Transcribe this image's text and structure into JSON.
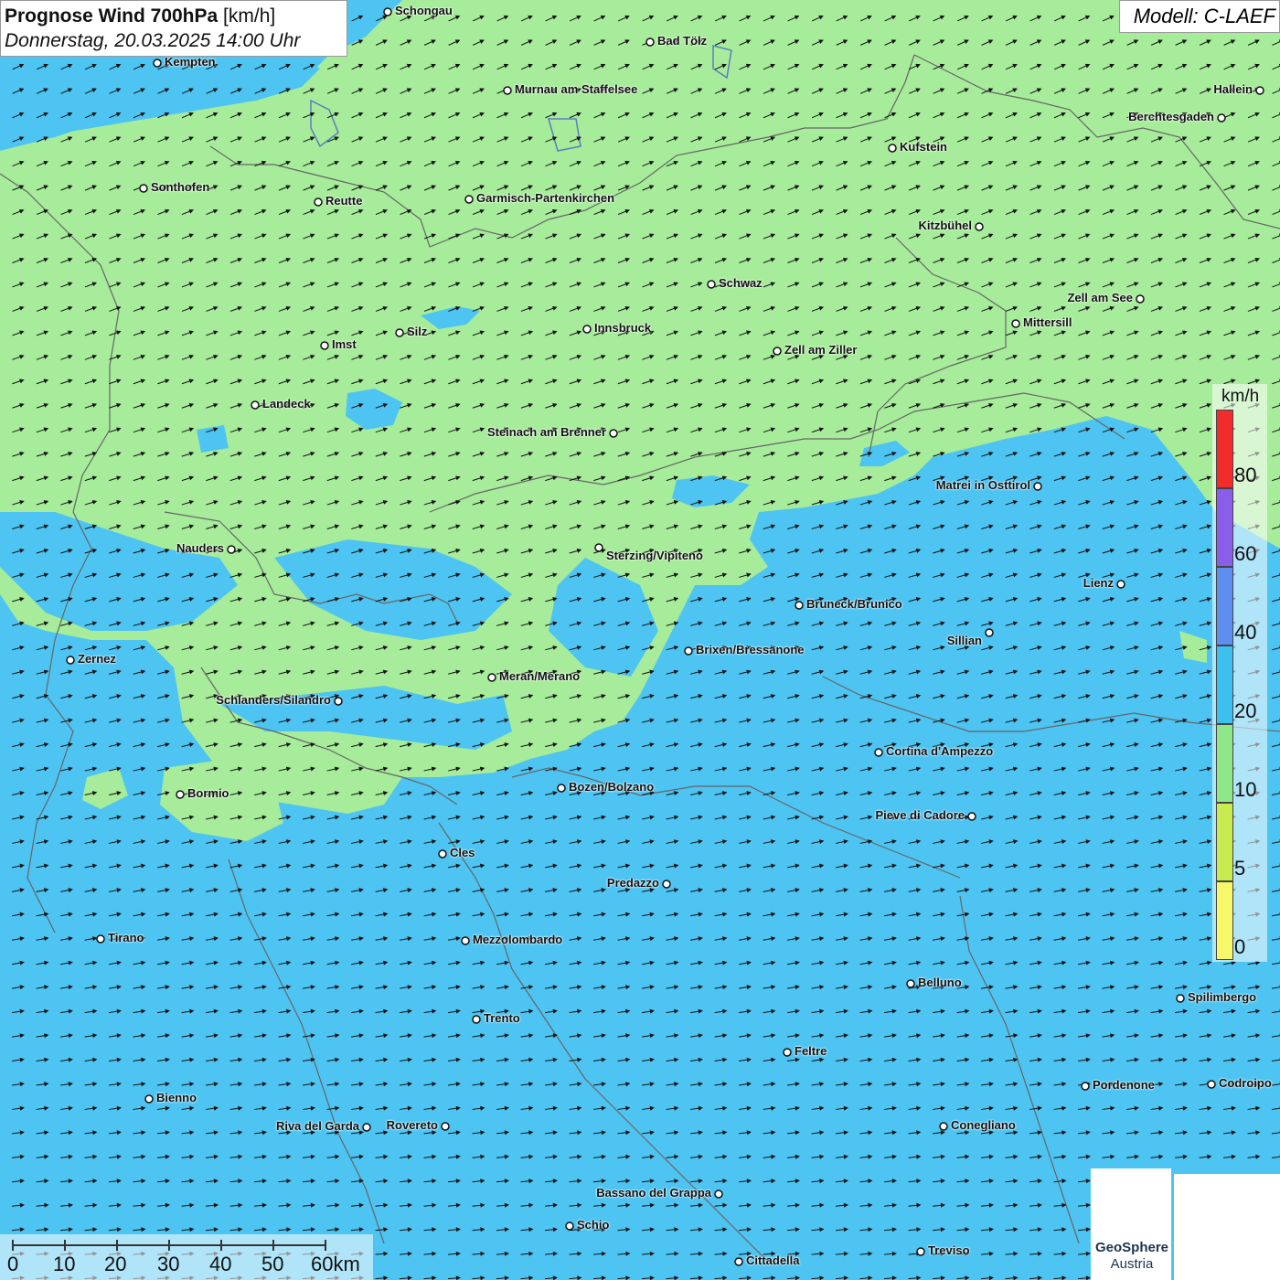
{
  "title": {
    "bold": "Prognose Wind 700hPa",
    "unit": "[km/h]",
    "date": "Donnerstag, 20.03.2025 14:00 Uhr"
  },
  "model": "Modell: C-LAEF",
  "legend": {
    "unit": "km/h",
    "ticks": [
      "80",
      "60",
      "40",
      "20",
      "10",
      "5",
      "0"
    ],
    "colors": [
      "#f22b2b",
      "#8a5ee8",
      "#5e8ef0",
      "#3bc0f0",
      "#8ee88a",
      "#c8ec50",
      "#f7f76a"
    ]
  },
  "scale_bar": {
    "labels": [
      "0",
      "10",
      "20",
      "30",
      "40",
      "50",
      "60km"
    ]
  },
  "logo": {
    "line1": "GeoSphere",
    "line2": "Austria"
  },
  "colors": {
    "calm_green": "#a6ec9a",
    "wind_blue": "#4ec4f2",
    "arrow": "#111111"
  },
  "cities": [
    {
      "name": "Schongau"
    },
    {
      "name": "Bad Tölz"
    },
    {
      "name": "Kempten"
    },
    {
      "name": "Murnau am Staffelsee"
    },
    {
      "name": "Hallein"
    },
    {
      "name": "Berchtesgaden"
    },
    {
      "name": "Kufstein"
    },
    {
      "name": "Sonthofen"
    },
    {
      "name": "Reutte"
    },
    {
      "name": "Garmisch-Partenkirchen"
    },
    {
      "name": "Kitzbühel"
    },
    {
      "name": "Schwaz"
    },
    {
      "name": "Zell am See"
    },
    {
      "name": "Mittersill"
    },
    {
      "name": "Innsbruck"
    },
    {
      "name": "Silz"
    },
    {
      "name": "Imst"
    },
    {
      "name": "Zell am Ziller"
    },
    {
      "name": "Landeck"
    },
    {
      "name": "Steinach am Brenner"
    },
    {
      "name": "Matrei in Osttirol"
    },
    {
      "name": "Nauders"
    },
    {
      "name": "Sterzing/Vipiteno"
    },
    {
      "name": "Lienz"
    },
    {
      "name": "Bruneck/Brunico"
    },
    {
      "name": "Sillian"
    },
    {
      "name": "Zernez"
    },
    {
      "name": "Brixen/Bressanone"
    },
    {
      "name": "Meran/Merano"
    },
    {
      "name": "Schlanders/Silandro"
    },
    {
      "name": "Cortina d'Ampezzo"
    },
    {
      "name": "Bozen/Bolzano"
    },
    {
      "name": "Bormio"
    },
    {
      "name": "Pieve di Cadore"
    },
    {
      "name": "Cles"
    },
    {
      "name": "Predazzo"
    },
    {
      "name": "Tirano"
    },
    {
      "name": "Mezzolombardo"
    },
    {
      "name": "Belluno"
    },
    {
      "name": "Spilimbergo"
    },
    {
      "name": "Trento"
    },
    {
      "name": "Feltre"
    },
    {
      "name": "Pordenone"
    },
    {
      "name": "Codroipo"
    },
    {
      "name": "Bienno"
    },
    {
      "name": "Riva del Garda"
    },
    {
      "name": "Rovereto"
    },
    {
      "name": "Conegliano"
    },
    {
      "name": "Bassano del Grappa"
    },
    {
      "name": "Schio"
    },
    {
      "name": "Treviso"
    },
    {
      "name": "Cittadella"
    }
  ]
}
